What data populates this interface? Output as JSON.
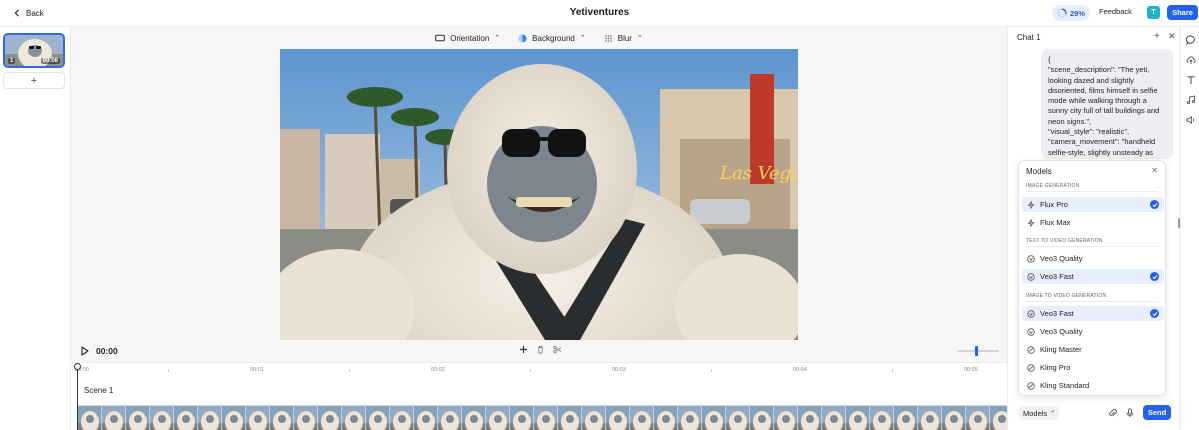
{
  "header": {
    "back_label": "Back",
    "title": "Yetiventures",
    "progress": "29%",
    "progress_value": 0.29,
    "feedback_label": "Feedback",
    "avatar_initial": "T",
    "share_label": "Share"
  },
  "colors": {
    "accent": "#2261e8",
    "selected_bg": "#e8eefc",
    "avatar_bg": "#20b2c8"
  },
  "scenes": {
    "items": [
      {
        "number": "1",
        "duration": "00:08"
      }
    ],
    "add_icon": "plus-icon"
  },
  "toolbar": {
    "orientation_label": "Orientation",
    "background_label": "Background",
    "blur_label": "Blur"
  },
  "playback": {
    "time": "00:00"
  },
  "timeline": {
    "ruler": [
      "00:00",
      "00:01",
      "00:02",
      "00:03",
      "00:04",
      "00:05"
    ],
    "scene_label": "Scene 1"
  },
  "chat": {
    "title": "Chat 1",
    "message": "{\n\"scene_description\": \"The yeti, looking dazed and slightly disoriented, films himself in selfie mode while walking through a sunny city full of tall buildings and neon signs.\",\n\"visual_style\": \"realistic\",\n\"camera_movement\": \"handheld selfie-style, slightly unsteady as",
    "models_button_label": "Models",
    "send_label": "Send"
  },
  "models_popover": {
    "title": "Models",
    "sections": [
      {
        "heading": "IMAGE GENERATION",
        "options": [
          {
            "label": "Flux Pro",
            "selected": true
          },
          {
            "label": "Flux Max",
            "selected": false
          }
        ]
      },
      {
        "heading": "TEXT TO VIDEO GENERATION",
        "options": [
          {
            "label": "Veo3 Quality",
            "selected": false
          },
          {
            "label": "Veo3 Fast",
            "selected": true
          }
        ]
      },
      {
        "heading": "IMAGE TO VIDEO GENERATION",
        "options": [
          {
            "label": "Veo3 Fast",
            "selected": true
          },
          {
            "label": "Veo3 Quality",
            "selected": false
          },
          {
            "label": "Kling Master",
            "selected": false
          },
          {
            "label": "Kling Pro",
            "selected": false
          },
          {
            "label": "Kling Standard",
            "selected": false
          }
        ]
      }
    ]
  }
}
